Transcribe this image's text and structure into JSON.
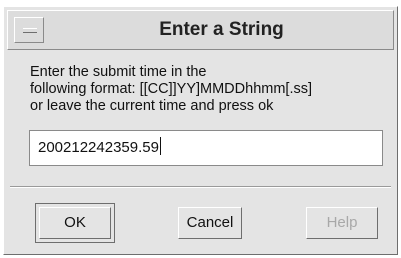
{
  "dialog": {
    "title": "Enter a String",
    "message": {
      "line1": "Enter the submit time in the",
      "line2": "following format: [[CC]]YY]MMDDhhmm[.ss]",
      "line3": "or leave the current time and press ok"
    },
    "input_value": "200212242359.59",
    "buttons": {
      "ok": "OK",
      "cancel": "Cancel",
      "help": "Help"
    },
    "help_enabled": false
  }
}
